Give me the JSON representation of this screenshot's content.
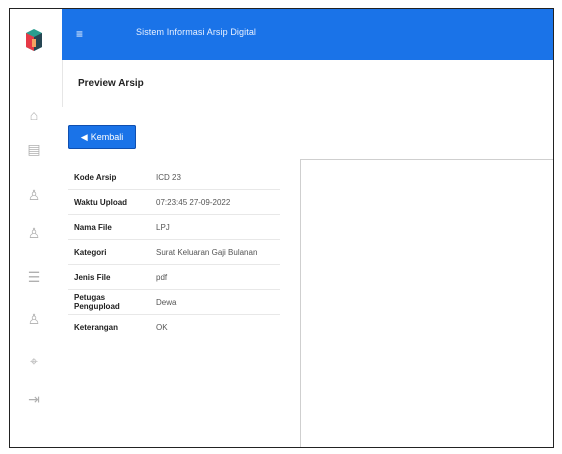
{
  "app": {
    "title": "Sistem Informasi Arsip Digital"
  },
  "page": {
    "title": "Preview Arsip"
  },
  "actions": {
    "back_label": "Kembali"
  },
  "details": [
    {
      "label": "Kode Arsip",
      "value": "ICD 23"
    },
    {
      "label": "Waktu Upload",
      "value": "07:23:45 27-09-2022"
    },
    {
      "label": "Nama File",
      "value": "LPJ"
    },
    {
      "label": "Kategori",
      "value": "Surat Keluaran Gaji Bulanan"
    },
    {
      "label": "Jenis File",
      "value": "pdf"
    },
    {
      "label": "Petugas Pengupload",
      "value": "Dewa"
    },
    {
      "label": "Keterangan",
      "value": "OK"
    }
  ],
  "sidebar": {
    "icons": [
      "home-icon",
      "archive-icon",
      "user-icon",
      "user-icon",
      "report-icon",
      "user-settings-icon",
      "lock-icon",
      "logout-icon"
    ]
  },
  "colors": {
    "primary": "#1a73e8"
  }
}
